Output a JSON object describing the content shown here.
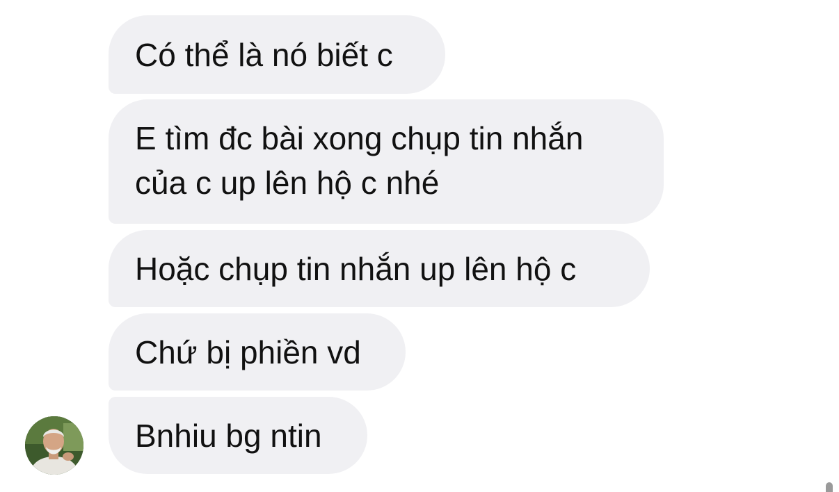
{
  "messages": [
    {
      "text": "Có thể là nó biết c"
    },
    {
      "text": "E tìm đc bài xong chụp tin nhắn của c up lên hộ c nhé"
    },
    {
      "text": "Hoặc chụp tin nhắn up lên hộ c"
    },
    {
      "text": "Chứ bị phiền vd"
    },
    {
      "text": "Bnhiu bg ntin"
    }
  ],
  "colors": {
    "bubble_background": "#f0f0f3",
    "text": "#111111",
    "page_background": "#ffffff"
  },
  "icons": {
    "avatar": "contact-avatar-photo"
  }
}
